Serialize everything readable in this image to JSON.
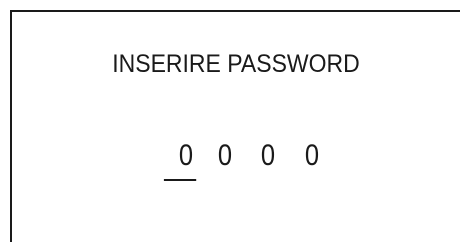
{
  "prompt": {
    "title": "INSERIRE PASSWORD"
  },
  "password": {
    "digits": [
      "0",
      "0",
      "0",
      "0"
    ],
    "active_index": 0
  }
}
